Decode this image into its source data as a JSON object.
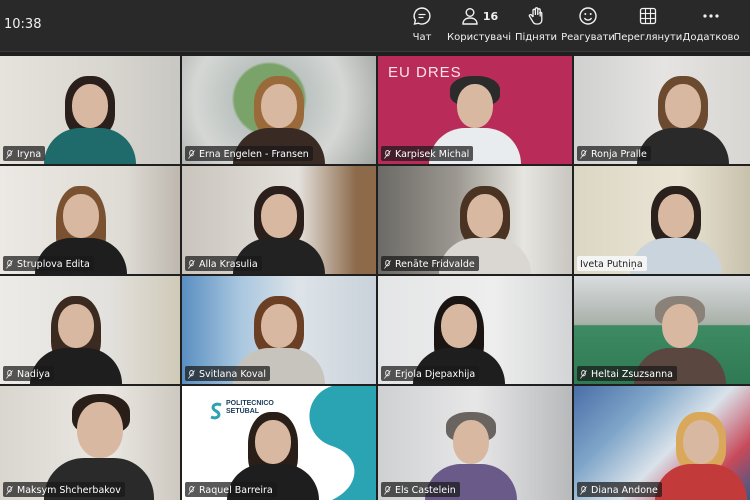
{
  "clock": "10:38",
  "toolbar": {
    "chat": "Чат",
    "people": "Користувачі",
    "people_count": "16",
    "raise": "Підняти",
    "react": "Реагувати",
    "view": "Переглянути",
    "more": "Додатково"
  },
  "colors": {
    "topbar": "#292929",
    "background": "#1f1f1f"
  },
  "participants": [
    {
      "name": "Iryna"
    },
    {
      "name": "Erna Engelen - Fransen"
    },
    {
      "name": "Karpisek Michal",
      "overlay": "EU DRES"
    },
    {
      "name": "Ronja Pralle"
    },
    {
      "name": "Struplova Edita"
    },
    {
      "name": "Alla Krasulia"
    },
    {
      "name": "Renāte Fridvalde"
    },
    {
      "name": "Iveta Putniņa"
    },
    {
      "name": "Nadiya"
    },
    {
      "name": "Svitlana Koval"
    },
    {
      "name": "Erjola Djepaxhija"
    },
    {
      "name": "Heltai Zsuzsanna"
    },
    {
      "name": "Maksym Shcherbakov"
    },
    {
      "name": "Raquel Barreira",
      "overlay": "POLITECNICO SETÚBAL"
    },
    {
      "name": "Els Castelein"
    },
    {
      "name": "Diana Andone"
    }
  ]
}
